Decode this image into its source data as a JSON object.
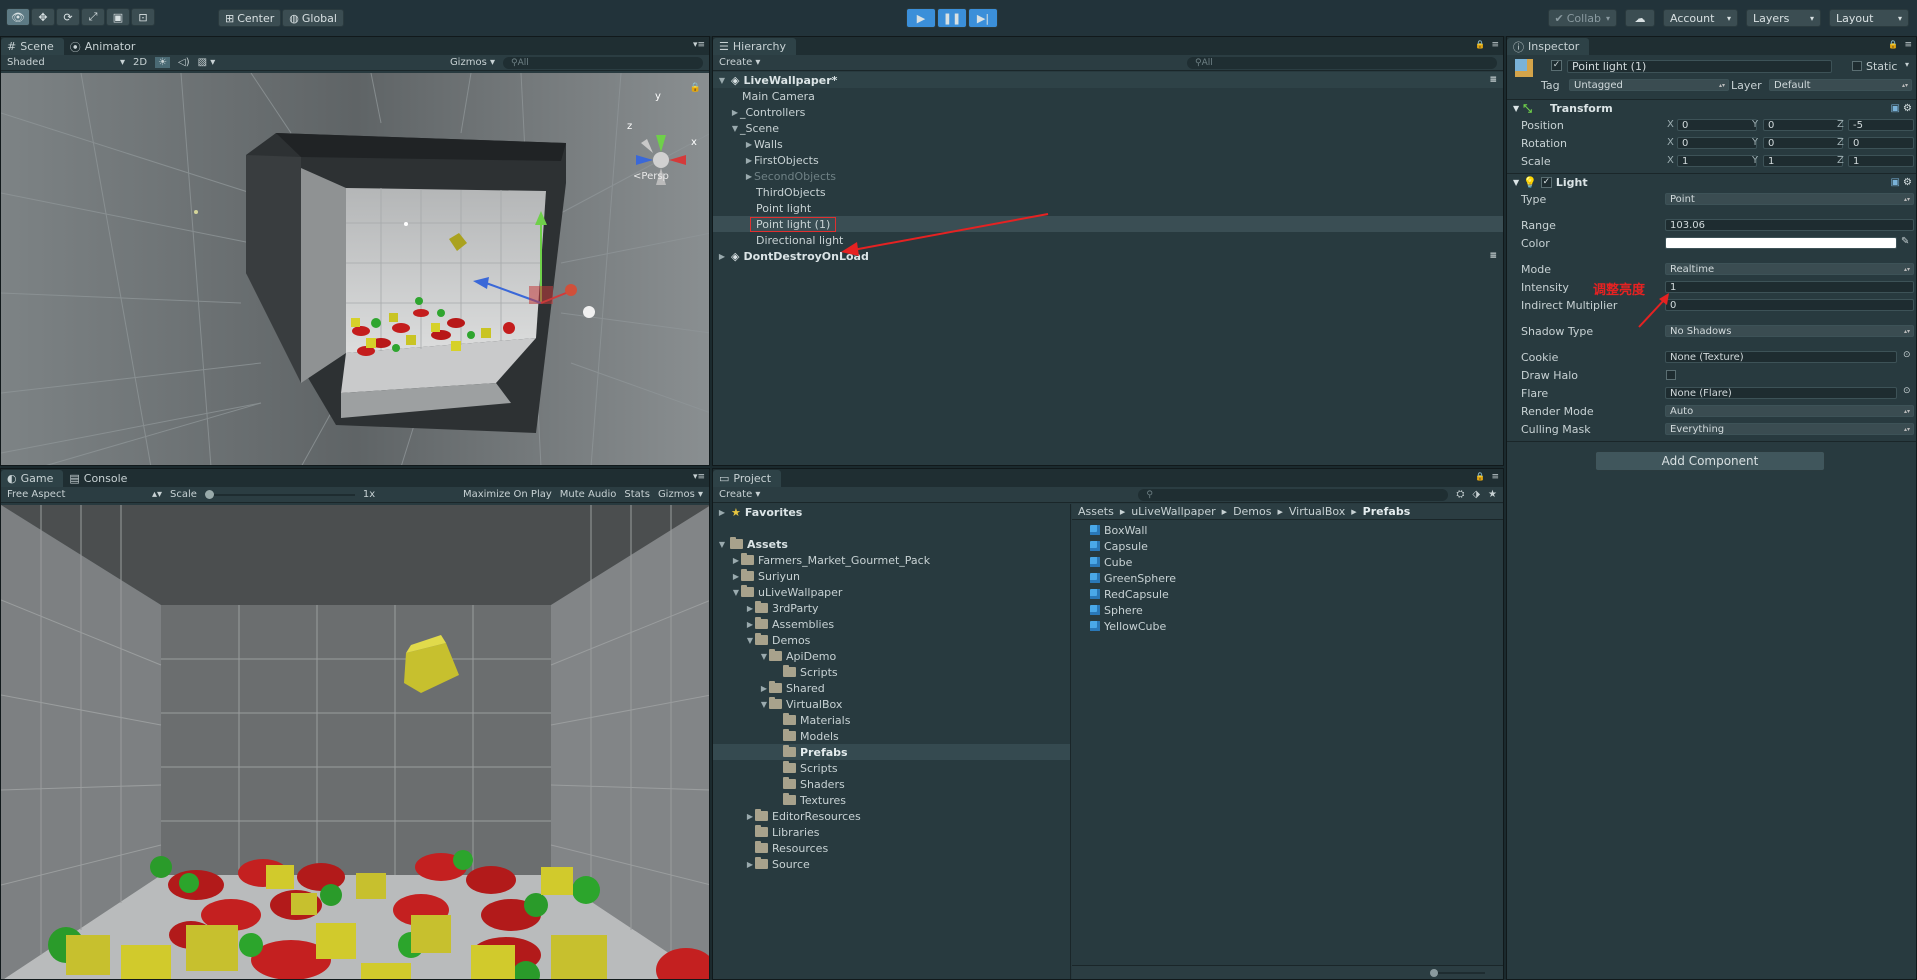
{
  "toolbar": {
    "center_label": "Center",
    "global_label": "Global",
    "collab_label": "Collab",
    "account_label": "Account",
    "layers_label": "Layers",
    "layout_label": "Layout",
    "accent": "#3b8fd9"
  },
  "scene_panel": {
    "tabs": [
      {
        "label": "Scene"
      },
      {
        "label": "Animator"
      }
    ],
    "shading_label": "Shaded",
    "mode_2d": "2D",
    "gizmos_label": "Gizmos",
    "search_placeholder": "All",
    "persp_label": "Persp",
    "axis_x": "x",
    "axis_y": "y",
    "axis_z": "z"
  },
  "game_panel": {
    "tabs": [
      {
        "label": "Game"
      },
      {
        "label": "Console"
      }
    ],
    "aspect_label": "Free Aspect",
    "scale_label": "Scale",
    "scale_value": "1x",
    "maximize_label": "Maximize On Play",
    "mute_label": "Mute Audio",
    "stats_label": "Stats",
    "gizmos_label": "Gizmos"
  },
  "hierarchy": {
    "tab_label": "Hierarchy",
    "create_label": "Create",
    "search_placeholder": "All",
    "items": [
      {
        "label": "LiveWallpaper*"
      },
      {
        "label": "Main Camera"
      },
      {
        "label": "_Controllers"
      },
      {
        "label": "_Scene"
      },
      {
        "label": "Walls"
      },
      {
        "label": "FirstObjects"
      },
      {
        "label": "SecondObjects"
      },
      {
        "label": "ThirdObjects"
      },
      {
        "label": "Point light"
      },
      {
        "label": "Point light (1)"
      },
      {
        "label": "Directional light"
      },
      {
        "label": "DontDestroyOnLoad"
      }
    ]
  },
  "project": {
    "tab_label": "Project",
    "create_label": "Create",
    "favorites_label": "Favorites",
    "tree": [
      {
        "label": "Assets"
      },
      {
        "label": "Farmers_Market_Gourmet_Pack"
      },
      {
        "label": "Suriyun"
      },
      {
        "label": "uLiveWallpaper"
      },
      {
        "label": "3rdParty"
      },
      {
        "label": "Assemblies"
      },
      {
        "label": "Demos"
      },
      {
        "label": "ApiDemo"
      },
      {
        "label": "Scripts"
      },
      {
        "label": "Shared"
      },
      {
        "label": "VirtualBox"
      },
      {
        "label": "Materials"
      },
      {
        "label": "Models"
      },
      {
        "label": "Prefabs"
      },
      {
        "label": "Scripts"
      },
      {
        "label": "Shaders"
      },
      {
        "label": "Textures"
      },
      {
        "label": "EditorResources"
      },
      {
        "label": "Libraries"
      },
      {
        "label": "Resources"
      },
      {
        "label": "Source"
      }
    ],
    "breadcrumb": [
      "Assets",
      "uLiveWallpaper",
      "Demos",
      "VirtualBox",
      "Prefabs"
    ],
    "files": [
      {
        "label": "BoxWall"
      },
      {
        "label": "Capsule"
      },
      {
        "label": "Cube"
      },
      {
        "label": "GreenSphere"
      },
      {
        "label": "RedCapsule"
      },
      {
        "label": "Sphere"
      },
      {
        "label": "YellowCube"
      }
    ]
  },
  "inspector": {
    "tab_label": "Inspector",
    "object_name": "Point light (1)",
    "static_label": "Static",
    "tag_label": "Tag",
    "tag_value": "Untagged",
    "layer_label": "Layer",
    "layer_value": "Default",
    "transform": {
      "title": "Transform",
      "position_label": "Position",
      "rotation_label": "Rotation",
      "scale_label": "Scale",
      "axis_x": "X",
      "axis_y": "Y",
      "axis_z": "Z",
      "position": [
        "0",
        "0",
        "-5"
      ],
      "rotation": [
        "0",
        "0",
        "0"
      ],
      "scale": [
        "1",
        "1",
        "1"
      ]
    },
    "light": {
      "title": "Light",
      "type_label": "Type",
      "type_value": "Point",
      "range_label": "Range",
      "range_value": "103.06",
      "color_label": "Color",
      "color_value": "#ffffff",
      "mode_label": "Mode",
      "mode_value": "Realtime",
      "intensity_label": "Intensity",
      "intensity_value": "1",
      "indirect_label": "Indirect Multiplier",
      "indirect_value": "0",
      "shadow_label": "Shadow Type",
      "shadow_value": "No Shadows",
      "cookie_label": "Cookie",
      "cookie_value": "None (Texture)",
      "halo_label": "Draw Halo",
      "flare_label": "Flare",
      "flare_value": "None (Flare)",
      "render_label": "Render Mode",
      "render_value": "Auto",
      "culling_label": "Culling Mask",
      "culling_value": "Everything"
    },
    "annotation": "调整亮度",
    "add_component_label": "Add Component"
  }
}
